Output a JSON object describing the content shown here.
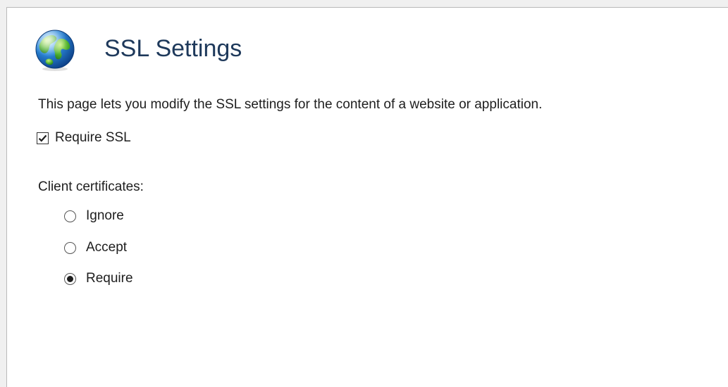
{
  "page": {
    "title": "SSL Settings",
    "icon": "globe-icon",
    "description": "This page lets you modify the SSL settings for the content of a website or application."
  },
  "require_ssl": {
    "label": "Require SSL",
    "checked": true
  },
  "client_certificates": {
    "label": "Client certificates:",
    "options": [
      {
        "label": "Ignore",
        "selected": false
      },
      {
        "label": "Accept",
        "selected": false
      },
      {
        "label": "Require",
        "selected": true
      }
    ]
  },
  "colors": {
    "title": "#1e395b",
    "text": "#1e1e1e",
    "background": "#ffffff",
    "frame": "#f0f0f0"
  }
}
